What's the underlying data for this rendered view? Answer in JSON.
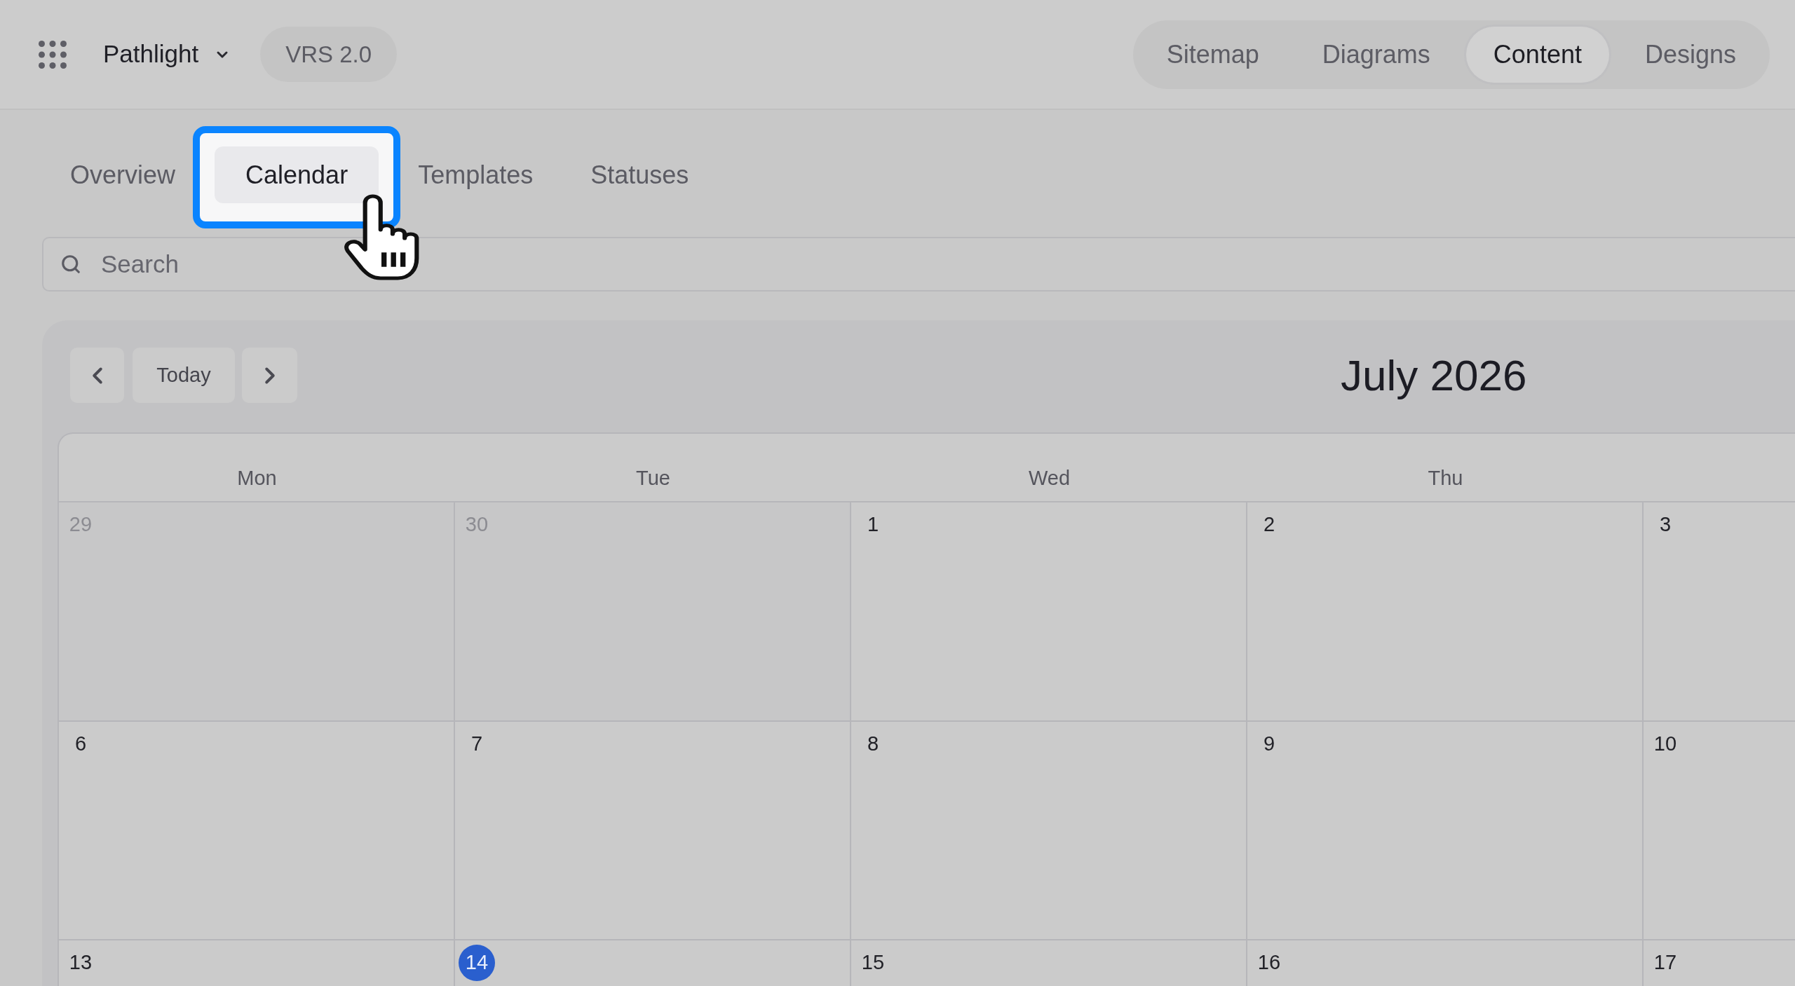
{
  "header": {
    "project": {
      "name": "Pathlight"
    },
    "version_badge": "VRS 2.0",
    "nav_tabs": [
      {
        "label": "Sitemap",
        "selected": false
      },
      {
        "label": "Diagrams",
        "selected": false
      },
      {
        "label": "Content",
        "selected": true
      },
      {
        "label": "Designs",
        "selected": false
      }
    ]
  },
  "tabs": [
    {
      "label": "Overview",
      "selected": false,
      "highlighted": false
    },
    {
      "label": "Calendar",
      "selected": true,
      "highlighted": true
    },
    {
      "label": "Templates",
      "selected": false,
      "highlighted": false
    },
    {
      "label": "Statuses",
      "selected": false,
      "highlighted": false
    }
  ],
  "search": {
    "placeholder": "Search"
  },
  "calendar": {
    "title": "July 2026",
    "today_button": "Today",
    "weekdays": [
      "Mon",
      "Tue",
      "Wed",
      "Thu"
    ],
    "weeks": [
      [
        {
          "day": "29",
          "outside_month": true,
          "today": false
        },
        {
          "day": "30",
          "outside_month": true,
          "today": false
        },
        {
          "day": "1",
          "outside_month": false,
          "today": false
        },
        {
          "day": "2",
          "outside_month": false,
          "today": false
        },
        {
          "day": "3",
          "outside_month": false,
          "today": false
        }
      ],
      [
        {
          "day": "6",
          "outside_month": false,
          "today": false
        },
        {
          "day": "7",
          "outside_month": false,
          "today": false
        },
        {
          "day": "8",
          "outside_month": false,
          "today": false
        },
        {
          "day": "9",
          "outside_month": false,
          "today": false
        },
        {
          "day": "10",
          "outside_month": false,
          "today": false
        }
      ],
      [
        {
          "day": "13",
          "outside_month": false,
          "today": false
        },
        {
          "day": "14",
          "outside_month": false,
          "today": true
        },
        {
          "day": "15",
          "outside_month": false,
          "today": false
        },
        {
          "day": "16",
          "outside_month": false,
          "today": false
        },
        {
          "day": "17",
          "outside_month": false,
          "today": false
        }
      ]
    ]
  }
}
